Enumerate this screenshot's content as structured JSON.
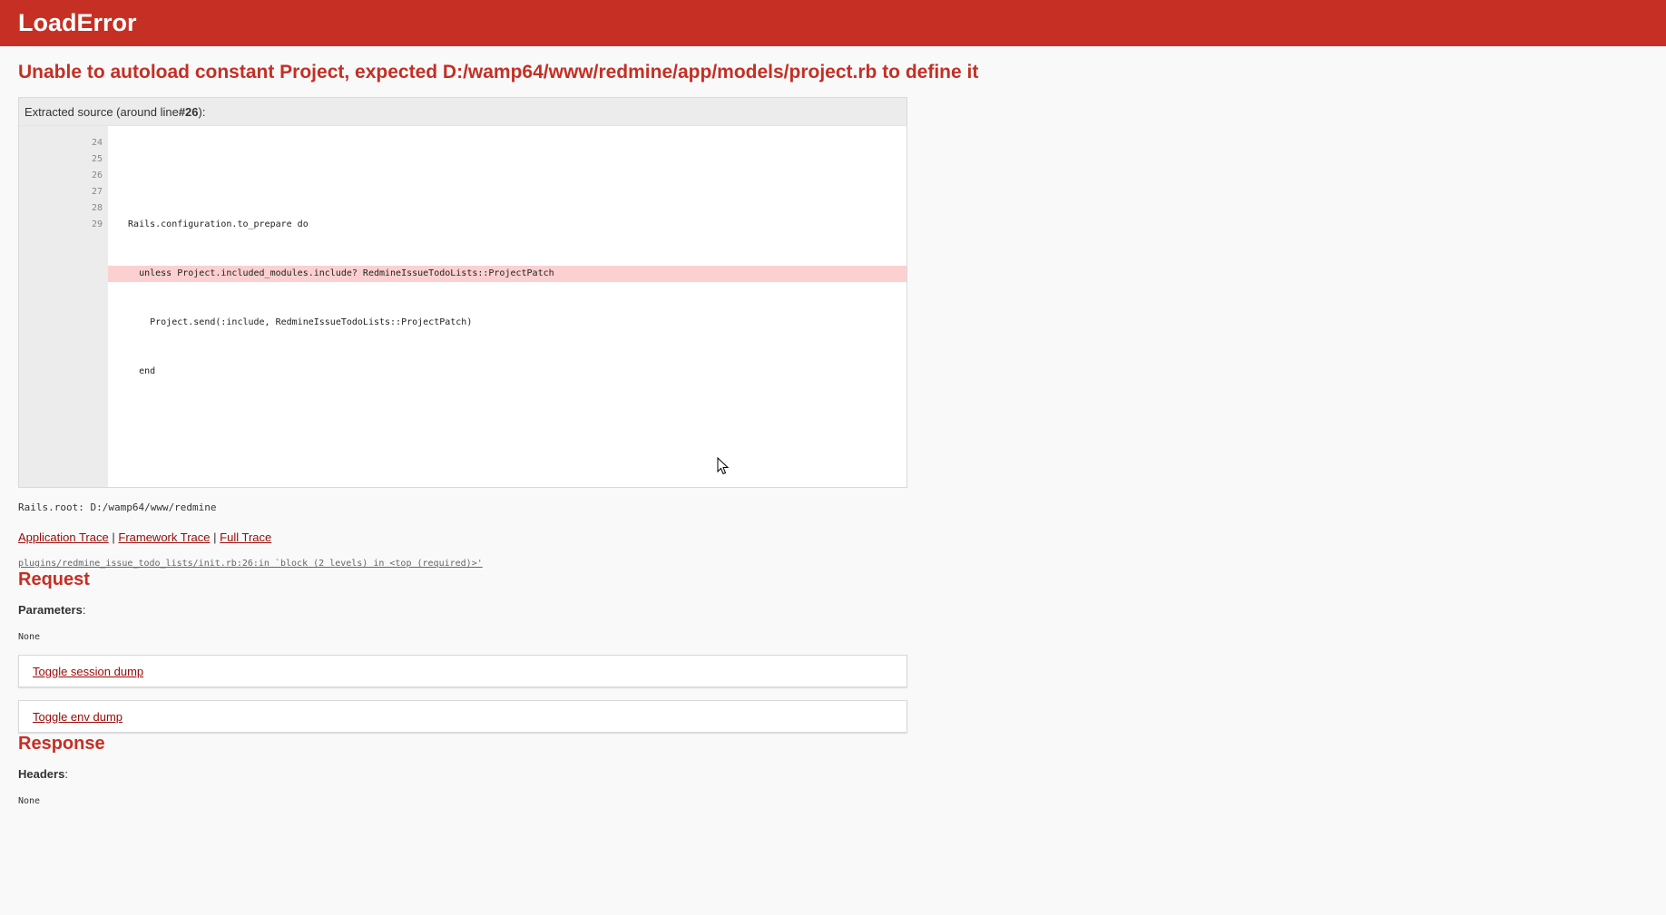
{
  "header": {
    "title": "LoadError"
  },
  "error": {
    "message": "Unable to autoload constant Project, expected D:/wamp64/www/redmine/app/models/project.rb to define it"
  },
  "source": {
    "info_prefix": "Extracted source (around line ",
    "info_line": "#26",
    "info_suffix": "):",
    "line_numbers": [
      "24",
      "25",
      "26",
      "27",
      "28",
      "29"
    ],
    "lines": [
      "",
      "  Rails.configuration.to_prepare do",
      "    unless Project.included_modules.include? RedmineIssueTodoLists::ProjectPatch",
      "      Project.send(:include, RedmineIssueTodoLists::ProjectPatch)",
      "    end",
      ""
    ]
  },
  "rails_root": "Rails.root: D:/wamp64/www/redmine",
  "trace_links": {
    "application": "Application Trace",
    "framework": "Framework Trace",
    "full": "Full Trace",
    "separator": "|"
  },
  "trace_line": "plugins/redmine_issue_todo_lists/init.rb:26:in `block (2 levels) in <top (required)>'",
  "request": {
    "title": "Request",
    "parameters_label": "Parameters",
    "parameters_value": "None",
    "toggle_session": "Toggle session dump",
    "toggle_env": "Toggle env dump"
  },
  "response": {
    "title": "Response",
    "headers_label": "Headers",
    "headers_value": "None"
  },
  "colors": {
    "accent": "#c52f24",
    "link": "#980905",
    "highlight": "#fcd0d0"
  }
}
